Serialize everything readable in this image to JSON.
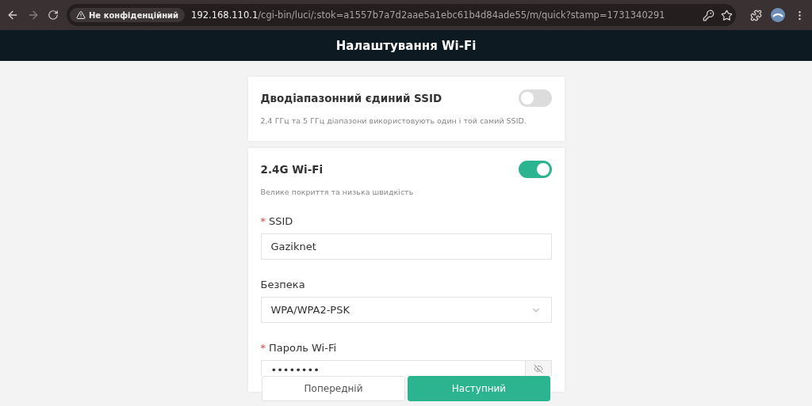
{
  "browser": {
    "security_label": "Не конфіденційний",
    "url_host": "192.168.110.1",
    "url_path": "/cgi-bin/luci/;stok=a1557b7a7d2aae5a1ebc61b4d84ade55/m/quick?stamp=1731340291"
  },
  "header": {
    "title": "Налаштування Wi-Fi"
  },
  "cards": [
    {
      "title": "Дводіапазонний єдиний SSID",
      "on": false,
      "description": "2,4 ГГц та 5 ГГц діапазони використовують один і той самий SSID."
    },
    {
      "title": "2.4G Wi-Fi",
      "on": true,
      "description": "Велике покриття та низька швидкість",
      "fields": [
        {
          "kind": "text",
          "required_mark": "*",
          "label": "SSID",
          "value": "Gaziknet"
        },
        {
          "kind": "select",
          "label": "Безпека",
          "value": "WPA/WPA2-PSK"
        },
        {
          "kind": "password",
          "required_mark": "*",
          "label": "Пароль Wi-Fi",
          "value": "••••••••"
        }
      ]
    }
  ],
  "buttons": [
    {
      "label": "Попередній",
      "primary": false
    },
    {
      "label": "Наступний",
      "primary": true
    }
  ]
}
